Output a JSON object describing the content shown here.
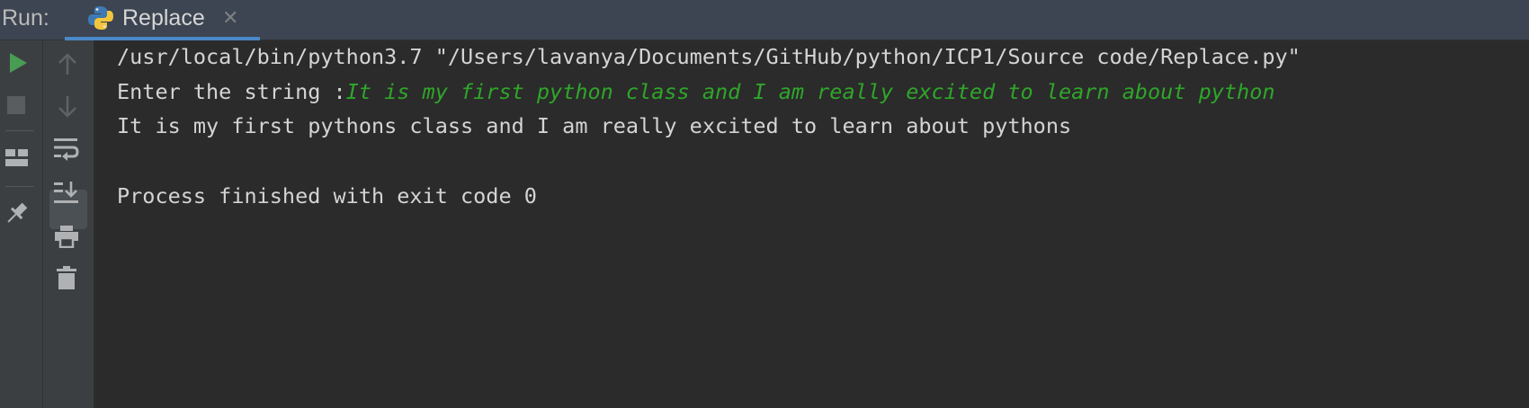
{
  "header": {
    "run_label": "Run:",
    "tab": {
      "label": "Replace",
      "icon": "python-icon",
      "close_icon": "close-icon"
    }
  },
  "toolbar": {
    "left": [
      "run-icon",
      "stop-icon",
      "layout-icon",
      "pin-icon"
    ],
    "right": [
      "up-arrow-icon",
      "down-arrow-icon",
      "soft-wrap-icon",
      "scroll-to-end-icon",
      "print-icon",
      "trash-icon"
    ]
  },
  "console": {
    "command": "/usr/local/bin/python3.7 \"/Users/lavanya/Documents/GitHub/python/ICP1/Source code/Replace.py\"",
    "prompt": "Enter the string :",
    "user_input": "It is my first python class and I am really excited to learn about python",
    "output": "It is my first pythons class and I am really excited to learn about pythons",
    "exit_message": "Process finished with exit code 0"
  },
  "colors": {
    "background": "#2b2b2b",
    "header": "#3c4551",
    "tab_underline": "#4a88c7",
    "input_text": "#2fa62a",
    "run_green": "#499c54"
  }
}
